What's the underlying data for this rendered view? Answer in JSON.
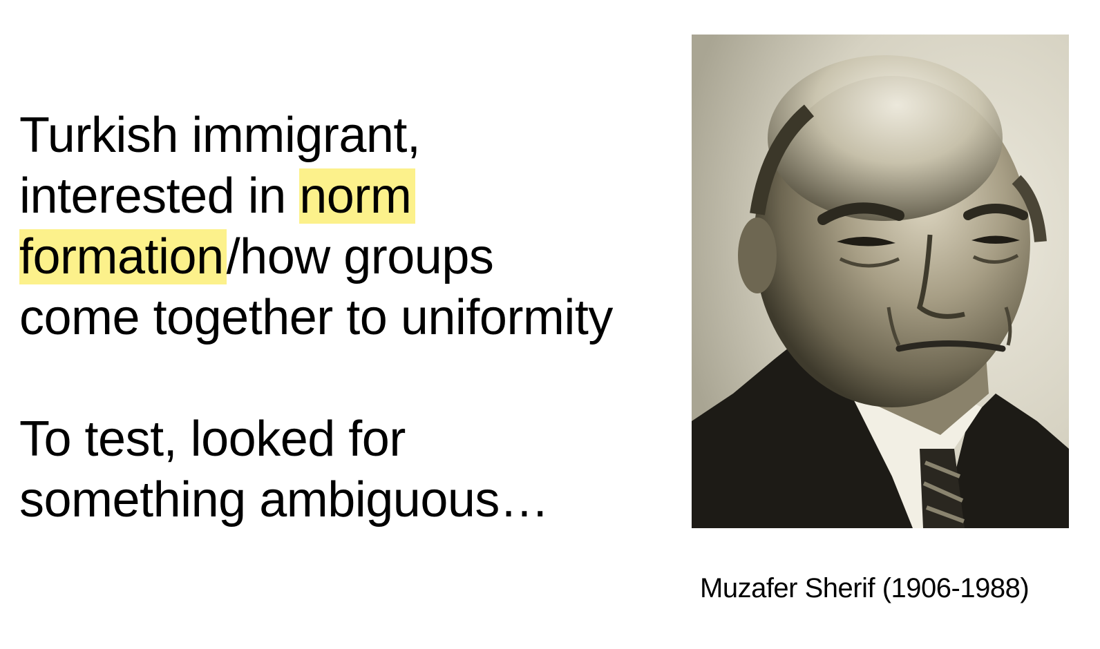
{
  "text": {
    "p1": {
      "line1": "Turkish immigrant,",
      "line2_pre": "interested in ",
      "highlight_1": "norm",
      "highlight_2": "formation",
      "line3_post": "/how groups",
      "line4": "come together to uniformity"
    },
    "p2": {
      "line1": "To test, looked for",
      "line2": "something ambiguous…"
    }
  },
  "photo": {
    "subject": "portrait of Muzafer Sherif"
  },
  "caption": "Muzafer Sherif (1906-1988)",
  "colors": {
    "highlight": "#fcf18b",
    "text": "#000000",
    "background": "#ffffff",
    "photo_tone": "#d9d5c6"
  }
}
